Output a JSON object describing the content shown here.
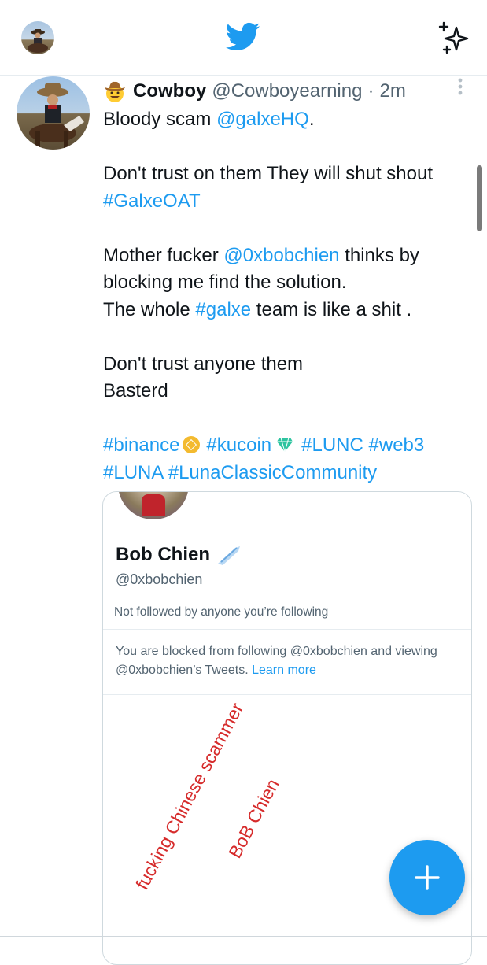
{
  "header": {
    "avatar_icon": "profile-avatar",
    "logo_icon": "twitter-bird-icon",
    "sparkle_icon": "sparkle-icon",
    "brand_color": "#1d9bf0"
  },
  "tweet": {
    "author_emoji": "cowboy-hat-face-emoji",
    "display_name": "Cowboy",
    "handle": "@Cowboyearning",
    "separator": "·",
    "time": "2m",
    "line1_text": "Bloody scam ",
    "line1_mention": "@galxeHQ",
    "line1_end": ".",
    "line2_text": "Don't trust on them They will shut shout",
    "line3_hashtag": "#GalxeOAT",
    "line4_text1": "Mother fucker ",
    "line4_mention": "@0xbobchien",
    "line4_text2": " thinks by",
    "line5_text": "blocking me find the solution.",
    "line6_text1": "The whole ",
    "line6_hashtag": "#galxe",
    "line6_text2": " team is  like a shit .",
    "line7_text": "Don't trust anyone them",
    "line8_text": "Basterd",
    "line9_hashtag1": "#binance",
    "line9_hashtag2": "#kucoin",
    "line9_hashtag3": "#LUNC",
    "line9_hashtag4": "#web3",
    "line10_hashtag1": "#LUNA",
    "line10_hashtag2": "#LunaClassicCommunity"
  },
  "card": {
    "name": "Bob Chien",
    "handle": "@0xbobchien",
    "follow_info": "Not followed by anyone you’re following",
    "blocked_text": "You are blocked from following @0xbobchien and viewing @0xbobchien’s Tweets.",
    "learn_more": "Learn more",
    "scribble_1": "fucking Chinese scammer",
    "scribble_2": "BoB Chien"
  },
  "fab": {
    "icon": "plus-icon"
  }
}
